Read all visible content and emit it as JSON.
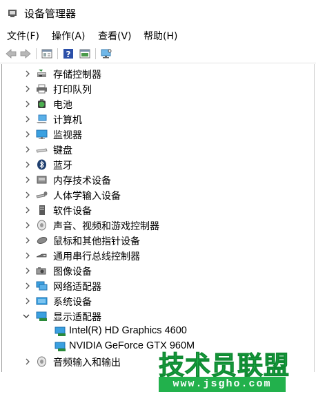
{
  "window": {
    "title": "设备管理器"
  },
  "menu": {
    "file": "文件(F)",
    "action": "操作(A)",
    "view": "查看(V)",
    "help": "帮助(H)"
  },
  "toolbar": {
    "buttons": [
      "back-icon",
      "forward-icon",
      "properties-icon",
      "help-icon",
      "panel-icon",
      "monitor-scan-icon"
    ]
  },
  "tree": {
    "items": [
      {
        "label": "存储控制器",
        "expanded": false,
        "icon": "storage-controller-icon"
      },
      {
        "label": "打印队列",
        "expanded": false,
        "icon": "printer-icon"
      },
      {
        "label": "电池",
        "expanded": false,
        "icon": "battery-icon"
      },
      {
        "label": "计算机",
        "expanded": false,
        "icon": "computer-icon"
      },
      {
        "label": "监视器",
        "expanded": false,
        "icon": "monitor-icon"
      },
      {
        "label": "键盘",
        "expanded": false,
        "icon": "keyboard-icon"
      },
      {
        "label": "蓝牙",
        "expanded": false,
        "icon": "bluetooth-icon"
      },
      {
        "label": "内存技术设备",
        "expanded": false,
        "icon": "memory-device-icon"
      },
      {
        "label": "人体学输入设备",
        "expanded": false,
        "icon": "hid-icon"
      },
      {
        "label": "软件设备",
        "expanded": false,
        "icon": "software-device-icon"
      },
      {
        "label": "声音、视频和游戏控制器",
        "expanded": false,
        "icon": "sound-icon"
      },
      {
        "label": "鼠标和其他指针设备",
        "expanded": false,
        "icon": "mouse-icon"
      },
      {
        "label": "通用串行总线控制器",
        "expanded": false,
        "icon": "usb-icon"
      },
      {
        "label": "图像设备",
        "expanded": false,
        "icon": "camera-icon"
      },
      {
        "label": "网络适配器",
        "expanded": false,
        "icon": "network-adapter-icon"
      },
      {
        "label": "系统设备",
        "expanded": false,
        "icon": "system-device-icon"
      },
      {
        "label": "显示适配器",
        "expanded": true,
        "icon": "display-adapter-icon"
      }
    ],
    "display_children": [
      {
        "label": "Intel(R) HD Graphics 4600",
        "icon": "display-adapter-icon"
      },
      {
        "label": "NVIDIA GeForce GTX 960M",
        "icon": "display-adapter-icon"
      }
    ],
    "last_item": {
      "label": "音频输入和输出",
      "expanded": false,
      "icon": "audio-io-icon"
    }
  },
  "watermark": {
    "title": "技术员联盟",
    "url": "www.jsgho.com",
    "color": "#22b14c"
  }
}
